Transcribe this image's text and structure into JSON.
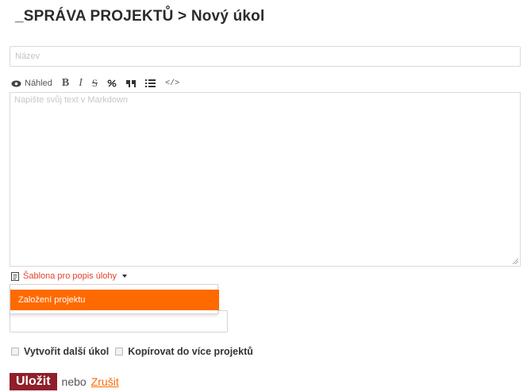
{
  "header": {
    "title": "_SPRÁVA PROJEKTŮ > Nový úkol"
  },
  "form": {
    "title_placeholder": "Název",
    "editor_placeholder": "Napište svůj text v Markdown",
    "toolbar": {
      "preview_label": "Náhled",
      "bold_glyph": "B",
      "italic_glyph": "I",
      "strike_glyph": "S",
      "link_glyph": "%",
      "quote_glyph": "99",
      "list_glyph": "☰",
      "code_glyph": "</>"
    },
    "template_label": "Šablona pro popis úlohy",
    "template_options": [
      "Založení projektu"
    ],
    "checkboxes": [
      {
        "label": "Vytvořit další úkol",
        "checked": false
      },
      {
        "label": "Kopírovat do více projektů",
        "checked": false
      }
    ],
    "save_label": "Uložit",
    "or_text": "nebo",
    "cancel_label": "Zrušit"
  },
  "colors": {
    "accent": "#ff6a00",
    "save_button": "#8f1f2a",
    "template_link": "#e0432a"
  }
}
